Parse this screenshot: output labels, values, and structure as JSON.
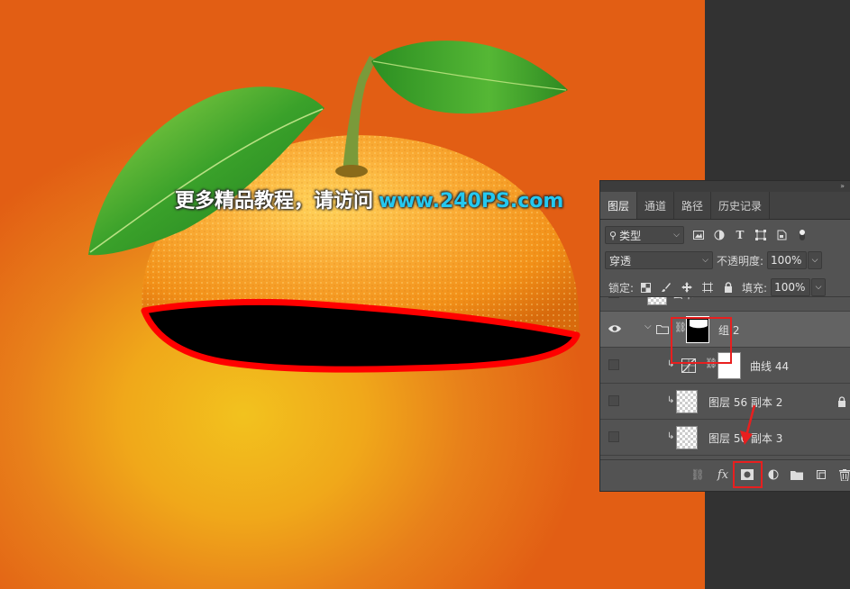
{
  "watermark": {
    "text": "更多精品教程，请访问",
    "url": "www.240PS.com"
  },
  "panel": {
    "tabs": [
      {
        "label": "图层",
        "active": true
      },
      {
        "label": "通道"
      },
      {
        "label": "路径"
      },
      {
        "label": "历史记录"
      }
    ],
    "filter": {
      "kind_label": "类型"
    },
    "blend": {
      "mode": "穿透",
      "opacity_label": "不透明度:",
      "opacity_value": "100%"
    },
    "lock": {
      "label": "锁定:",
      "fill_label": "填充:",
      "fill_value": "100%"
    },
    "layers": [
      {
        "name": "公本",
        "visible": false
      },
      {
        "name": "组 2",
        "visible": true,
        "selected": true,
        "type": "group"
      },
      {
        "name": "曲线 44",
        "visible": false,
        "type": "curves"
      },
      {
        "name": "图层 56 副本 2",
        "visible": false,
        "locked": true
      },
      {
        "name": "图层 56 副本 3",
        "visible": false
      }
    ]
  },
  "colors": {
    "highlight_red": "#e81f1f",
    "url_cyan": "#24c8f0",
    "panel_bg": "#535353",
    "workspace_bg": "#323232"
  }
}
